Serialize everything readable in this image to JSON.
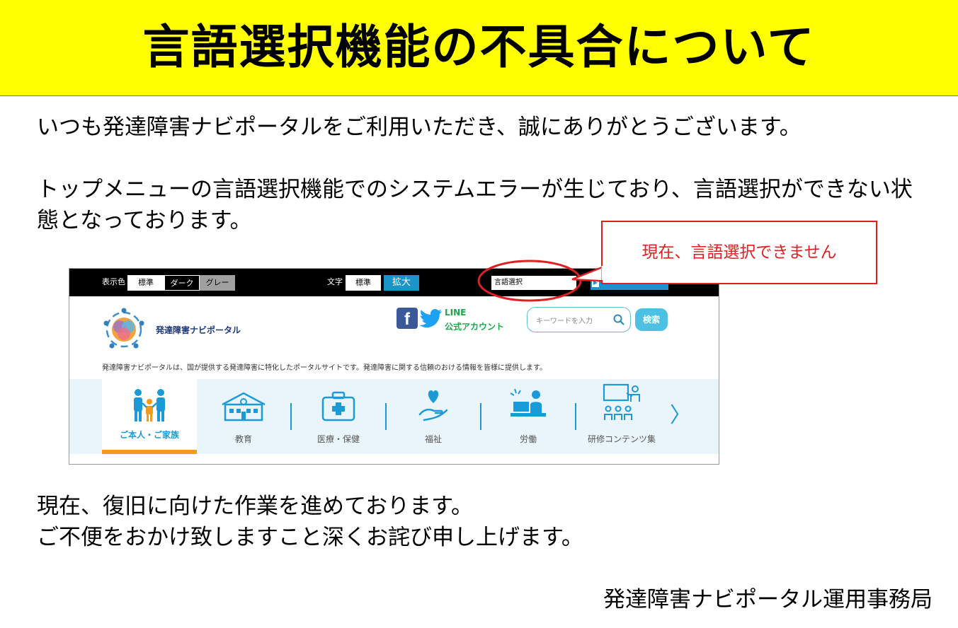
{
  "slide": {
    "title": "言語選択機能の不具合について",
    "paragraph1": "いつも発達障害ナビポータルをご利用いただき、誠にありがとうございます。",
    "paragraph2_line1": "トップメニューの言語選択機能でのシステムエラーが生じており、言語選択ができない状",
    "paragraph2_line2": "態となっております。",
    "paragraph3_line1": "現在、復旧に向けた作業を進めております。",
    "paragraph3_line2": "ご不便をおかけ致しますこと深くお詫び申し上げます。",
    "signature": "発達障害ナビポータル運用事務局",
    "callout": "現在、言語選択できません"
  },
  "screenshot": {
    "topbar": {
      "display_color_label": "表示色",
      "display_options": [
        "標準",
        "ダーク",
        "グレー"
      ],
      "text_size_label": "文字",
      "text_options": [
        "標準",
        "拡大"
      ],
      "language_select_value": "言語選択"
    },
    "header": {
      "site_name": "発達障害ナビポータル",
      "line_label_1": "LINE",
      "line_label_2": "公式アカウント",
      "search_placeholder": "キーワードを入力",
      "search_button": "検索",
      "description": "発達障害ナビポータルは、国が提供する発達障害に特化したポータルサイトです。発達障害に関する信頼のおける情報を皆様に提供します。"
    },
    "nav": {
      "items": [
        {
          "label": "ご本人・ご家族",
          "icon": "family-icon",
          "active": true
        },
        {
          "label": "教育",
          "icon": "school-icon"
        },
        {
          "label": "医療・保健",
          "icon": "medical-kit-icon"
        },
        {
          "label": "福祉",
          "icon": "heart-hand-icon"
        },
        {
          "label": "労働",
          "icon": "work-icon"
        },
        {
          "label": "研修コンテンツ集",
          "icon": "training-icon"
        }
      ],
      "next_icon": "chevron-right-icon"
    },
    "colors": {
      "accent_blue": "#1b95c9",
      "active_tab_underline": "#f29b1c",
      "title_band": "#ffff00",
      "callout_red": "#e02020"
    }
  }
}
